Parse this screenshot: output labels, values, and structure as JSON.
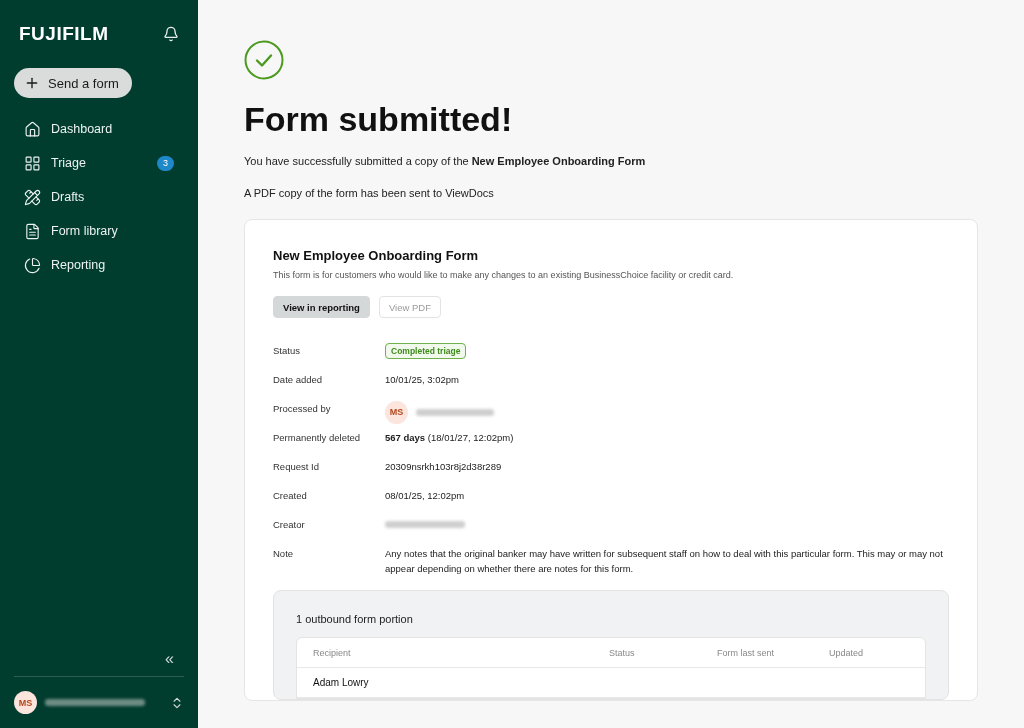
{
  "sidebar": {
    "logo": "FUJIFILM",
    "send_button": "Send a form",
    "items": [
      {
        "label": "Dashboard"
      },
      {
        "label": "Triage",
        "badge": "3"
      },
      {
        "label": "Drafts"
      },
      {
        "label": "Form library"
      },
      {
        "label": "Reporting"
      }
    ],
    "collapse": "«",
    "user": {
      "initials": "MS"
    }
  },
  "main": {
    "title": "Form submitted!",
    "message": "You have successfully submitted a copy of the **New Employee Onboarding Form**",
    "pdf_note": "A PDF copy of the form has been sent to ViewDocs",
    "card": {
      "title": "New Employee Onboarding Form",
      "description": "This form is for customers who would like to make any changes to an existing BusinessChoice facility or credit card.",
      "buttons": [
        {
          "label": "View in reporting",
          "disabled": false
        },
        {
          "label": "View PDF",
          "disabled": true
        }
      ],
      "details": [
        {
          "label": "Status",
          "kind": "badge",
          "value": "Completed triage"
        },
        {
          "label": "Date added",
          "kind": "text",
          "value": "10/01/25, 3:02pm"
        },
        {
          "label": "Processed by",
          "kind": "person",
          "initials": "MS"
        },
        {
          "label": "Permanently deleted",
          "kind": "text",
          "value": "**567 days** (18/01/27, 12:02pm)"
        },
        {
          "label": "Request Id",
          "kind": "text",
          "value": "20309nsrkh103r8j2d38r289"
        },
        {
          "label": "Created",
          "kind": "text",
          "value": "08/01/25, 12:02pm"
        },
        {
          "label": "Creator",
          "kind": "hidden"
        },
        {
          "label": "Note",
          "kind": "text",
          "value": "Any notes that the original banker may have written for subsequent staff on how to deal with this particular form. This may or may not appear depending on whether there are notes for this form."
        }
      ],
      "outbound": {
        "title": "1 outbound form portion",
        "columns": [
          "Recipient",
          "Status",
          "Form last sent",
          "Updated"
        ],
        "rows": [
          [
            "Adam Lowry"
          ]
        ]
      }
    }
  }
}
